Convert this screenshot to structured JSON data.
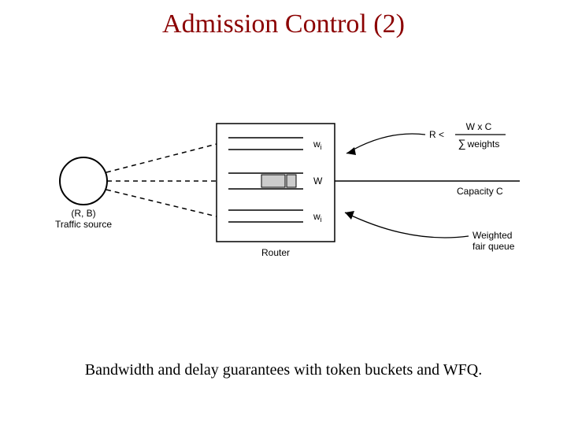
{
  "title": "Admission Control (2)",
  "caption": "Bandwidth and delay guarantees with token buckets and WFQ.",
  "source": {
    "params": "(R, B)",
    "label": "Traffic source"
  },
  "router": {
    "label": "Router",
    "queues": {
      "top_weight": "w",
      "top_sub": "i",
      "mid_weight": "W",
      "bot_weight": "w",
      "bot_sub": "i"
    }
  },
  "formula": {
    "lhs": "R <",
    "numerator": "W x C",
    "denominator_symbol": "∑",
    "denominator_text": "weights"
  },
  "output": {
    "capacity": "Capacity C",
    "wfq1": "Weighted",
    "wfq2": "fair queue"
  }
}
